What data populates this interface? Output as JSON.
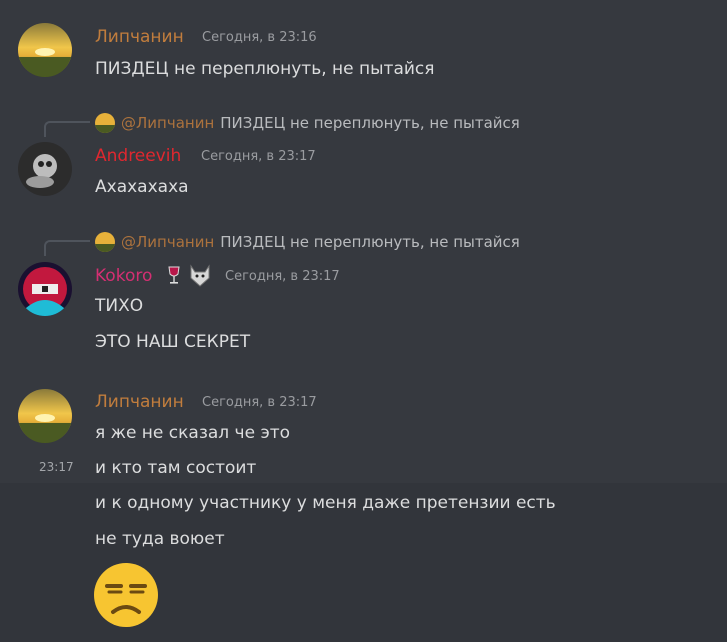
{
  "colors": {
    "lipchanin": "#c17d3d",
    "andreevih": "#e0272f",
    "kokoro": "#d42f72",
    "text": "#dcddde",
    "timestamp": "#9a9ca0",
    "background": "#36393f"
  },
  "messages": [
    {
      "author": "Липчанин",
      "timestamp": "Сегодня, в 23:16",
      "lines": [
        "ПИЗДЕЦ не переплюнуть, не пытайся"
      ]
    },
    {
      "reply": {
        "mention": "@Липчанин",
        "text": "ПИЗДЕЦ не переплюнуть, не пытайся"
      },
      "author": "Andreevih",
      "timestamp": "Сегодня, в 23:17",
      "lines": [
        "Ахахахаха"
      ]
    },
    {
      "reply": {
        "mention": "@Липчанин",
        "text": "ПИЗДЕЦ не переплюнуть, не пытайся"
      },
      "author": "Kokoro",
      "badges": [
        "wine-glass-icon",
        "wolf-icon"
      ],
      "timestamp": "Сегодня, в 23:17",
      "lines": [
        "ТИХО",
        "ЭТО НАШ СЕКРЕТ"
      ]
    },
    {
      "author": "Липчанин",
      "timestamp": "Сегодня, в 23:17",
      "side_timestamp": "23:17",
      "lines": [
        "я же не сказал че это",
        "и кто там состоит",
        "и к одному участнику у меня даже претензии есть",
        "не туда воюет"
      ],
      "emoji": "unamused-face-icon"
    }
  ]
}
